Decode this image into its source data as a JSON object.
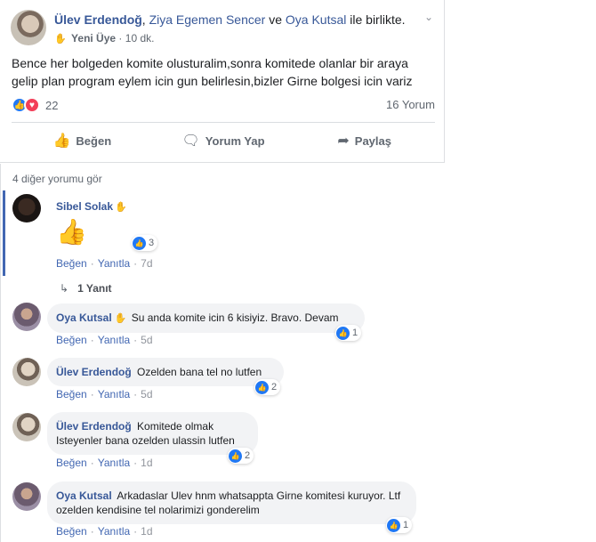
{
  "post": {
    "author": "Ülev Erdendoğ",
    "with_prefix": ", ",
    "tagged_1": "Ziya Egemen Sencer",
    "with_mid": " ve ",
    "tagged_2": "Oya Kutsal",
    "with_suffix": " ile birlikte.",
    "badge": "Yeni Üye",
    "time": "10 dk.",
    "text": "Bence her bolgeden komite olusturalim,sonra komitede olanlar bir araya gelip plan program eylem icin gun belirlesin,bizler Girne bolgesi icin variz",
    "reaction_count": "22",
    "comment_count": "16 Yorum"
  },
  "actions": {
    "like": "Beğen",
    "comment": "Yorum Yap",
    "share": "Paylaş"
  },
  "comments_section": {
    "see_more": "4 diğer yorumu gör"
  },
  "comments": [
    {
      "name": "Sibel Solak",
      "text": "",
      "reactions": "3",
      "like": "Beğen",
      "reply": "Yanıtla",
      "time": "7d",
      "reply_link": "1 Yanıt"
    },
    {
      "name": "Oya Kutsal",
      "text": "Su anda komite icin 6 kisiyiz. Bravo. Devam",
      "reactions": "1",
      "like": "Beğen",
      "reply": "Yanıtla",
      "time": "5d"
    },
    {
      "name": "Ülev Erdendoğ",
      "text": "Ozelden bana tel no lutfen",
      "reactions": "2",
      "like": "Beğen",
      "reply": "Yanıtla",
      "time": "5d"
    },
    {
      "name": "Ülev Erdendoğ",
      "text": "Komitede olmak Isteyenler bana ozelden ulassin lutfen",
      "reactions": "2",
      "like": "Beğen",
      "reply": "Yanıtla",
      "time": "1d"
    },
    {
      "name": "Oya Kutsal",
      "text": "Arkadaslar Ulev hnm whatsappta Girne komitesi kuruyor. Ltf ozelden kendisine tel nolarimizi gonderelim",
      "reactions": "1",
      "like": "Beğen",
      "reply": "Yanıtla",
      "time": "1d"
    }
  ]
}
